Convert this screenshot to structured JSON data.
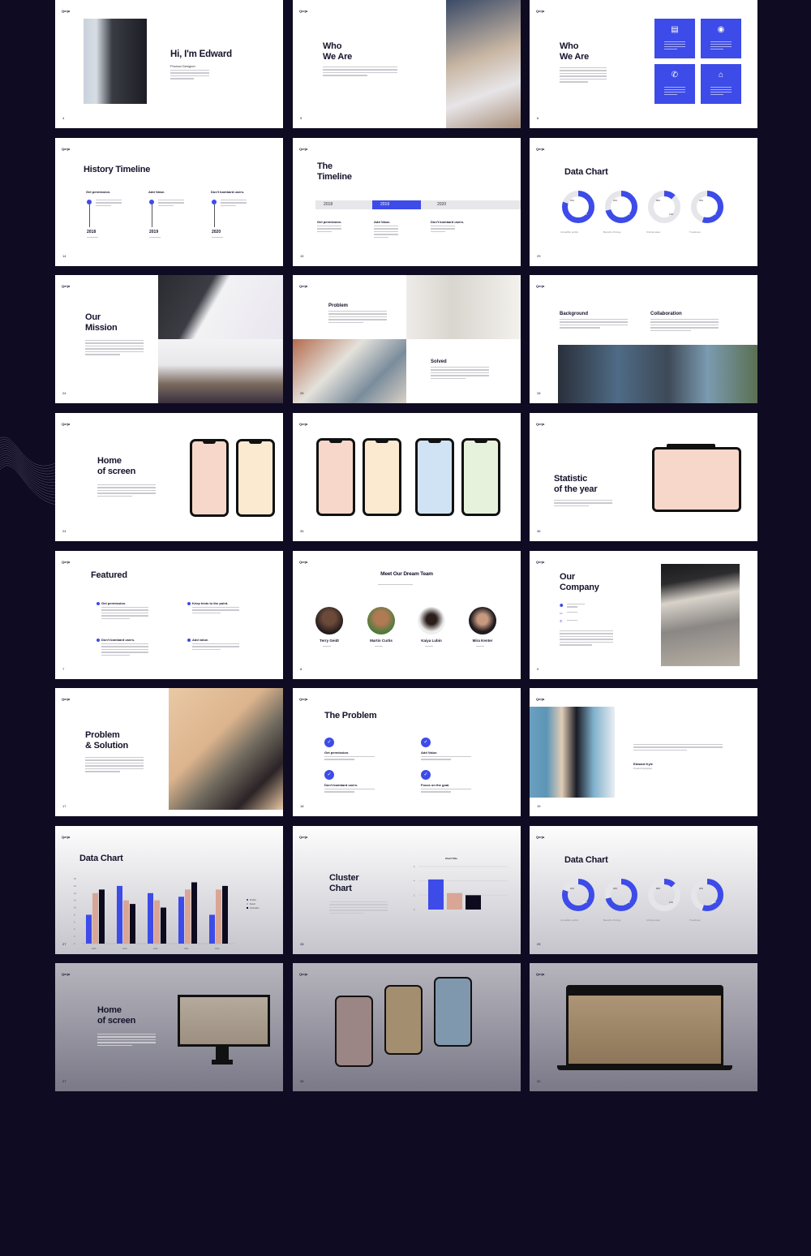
{
  "brand": "Qerja",
  "colors": {
    "background": "#0e0b22",
    "accent": "#3d4be8",
    "pink": "#d9a595",
    "dark": "#0d0a1e",
    "donut_track": "#e6e6ea"
  },
  "slides": [
    {
      "type": "intro",
      "page": "4",
      "title": "Hi, I'm Edward",
      "subtitle": "Product Designer"
    },
    {
      "type": "who_photo",
      "page": "5",
      "title": "Who\nWe Are"
    },
    {
      "type": "who_tiles",
      "page": "6",
      "title": "Who\nWe Are",
      "tiles": [
        {
          "icon": "chat-icon"
        },
        {
          "icon": "user-icon"
        },
        {
          "icon": "phone-icon"
        },
        {
          "icon": "store-icon"
        }
      ]
    },
    {
      "type": "history",
      "page": "14",
      "title": "History Timeline",
      "items": [
        {
          "head": "Get permission.",
          "year": "2018"
        },
        {
          "head": "Add Value.",
          "year": "2019"
        },
        {
          "head": "Don't bombard users.",
          "year": "2020"
        }
      ]
    },
    {
      "type": "timeline",
      "page": "15",
      "title": "The\nTimeline",
      "years": [
        "2018",
        "2019",
        "2020"
      ],
      "active": "2019",
      "items": [
        "Get permission.",
        "Add Value.",
        "Don't bombard users."
      ]
    },
    {
      "type": "donuts",
      "page": "29",
      "title": "Data Chart"
    },
    {
      "type": "mission",
      "page": "24",
      "title": "Our\nMission"
    },
    {
      "type": "problem_solved",
      "page": "25",
      "problem": "Problem",
      "solved": "Solved"
    },
    {
      "type": "background",
      "page": "28",
      "left": "Background",
      "right": "Collaboration"
    },
    {
      "type": "home_phones",
      "page": "24",
      "title": "Home\nof screen",
      "phone_colors": [
        "#f6d7c9",
        "#fbead0"
      ]
    },
    {
      "type": "four_phones",
      "page": "35",
      "phone_colors": [
        "#f6d7c9",
        "#fbead0",
        "#cfe3f5",
        "#e7f2dc"
      ]
    },
    {
      "type": "statistic",
      "page": "36",
      "title": "Statistic\nof the year",
      "screen_color": "#f6d7c9"
    },
    {
      "type": "featured",
      "page": "7",
      "title": "Featured",
      "items": [
        "Get permission.",
        "Keep texts to the point.",
        "Don't bombard users.",
        "Add value."
      ]
    },
    {
      "type": "team",
      "page": "8",
      "title": "Meet Our Dream Team",
      "members": [
        {
          "name": "Terry Geidt"
        },
        {
          "name": "Martin Curtis"
        },
        {
          "name": "Kaiya Lubin"
        },
        {
          "name": "Mira Kenter"
        }
      ]
    },
    {
      "type": "company",
      "page": "9",
      "title": "Our\nCompany"
    },
    {
      "type": "problem_solution",
      "page": "17",
      "title": "Problem\n& Solution"
    },
    {
      "type": "the_problem",
      "page": "18",
      "title": "The Problem",
      "items": [
        "Get permission.",
        "Add Value.",
        "Don't bombard users.",
        "Focus on the goal."
      ]
    },
    {
      "type": "profile",
      "page": "19",
      "name": "Edward Kyle",
      "role": "Product Designer"
    },
    {
      "type": "bar_chart",
      "page": "27",
      "title": "Data Chart",
      "bg": "g1"
    },
    {
      "type": "cluster",
      "page": "28",
      "title": "Cluster\nChart",
      "bg": "g1"
    },
    {
      "type": "donuts",
      "page": "29",
      "title": "Data Chart",
      "bg": "g1"
    },
    {
      "type": "monitor",
      "page": "27",
      "title": "Home\nof screen",
      "bg": "g2",
      "screen_color": "#aa9e90"
    },
    {
      "type": "tilted_phones",
      "page": "30",
      "bg": "g2",
      "phone_colors": [
        "#9b8585",
        "#a48e70",
        "#8098ae"
      ]
    },
    {
      "type": "laptop",
      "page": "31",
      "bg": "g2",
      "screen_color": "#a58d6f"
    }
  ],
  "chart_data": [
    {
      "type": "bar",
      "title": "Data Chart",
      "categories": [
        "2018",
        "2019",
        "2020",
        "2021",
        "2022"
      ],
      "ylim": [
        0,
        18
      ],
      "yticks": [
        0,
        2,
        4,
        6,
        8,
        10,
        12,
        14,
        16,
        18
      ],
      "legend": "right",
      "series": [
        {
          "name": "Product",
          "color": "#3d4be8",
          "values": [
            8,
            16,
            14,
            13,
            8
          ]
        },
        {
          "name": "Result",
          "color": "#d9a595",
          "values": [
            14,
            12,
            12,
            15,
            15
          ]
        },
        {
          "name": "Information",
          "color": "#0d0a1e",
          "values": [
            15,
            11,
            10,
            17,
            16
          ]
        }
      ]
    },
    {
      "type": "bar",
      "title": "Chart Title",
      "ylim": [
        0,
        6
      ],
      "yticks": [
        0,
        2,
        4,
        6
      ],
      "values": [
        4.2,
        2.3,
        2.0
      ],
      "colors": [
        "#3d4be8",
        "#d9a595",
        "#0d0a1e"
      ]
    },
    {
      "type": "pie",
      "title": "Data Chart",
      "series": [
        {
          "label": "Incredible profits",
          "value": 80,
          "rest": 20
        },
        {
          "label": "Benefit of things",
          "value": 71,
          "rest": 29
        },
        {
          "label": "Critical sales",
          "value": 12,
          "rest": 88
        },
        {
          "label": "Trustiness",
          "value": 55,
          "rest": 45
        }
      ]
    }
  ]
}
